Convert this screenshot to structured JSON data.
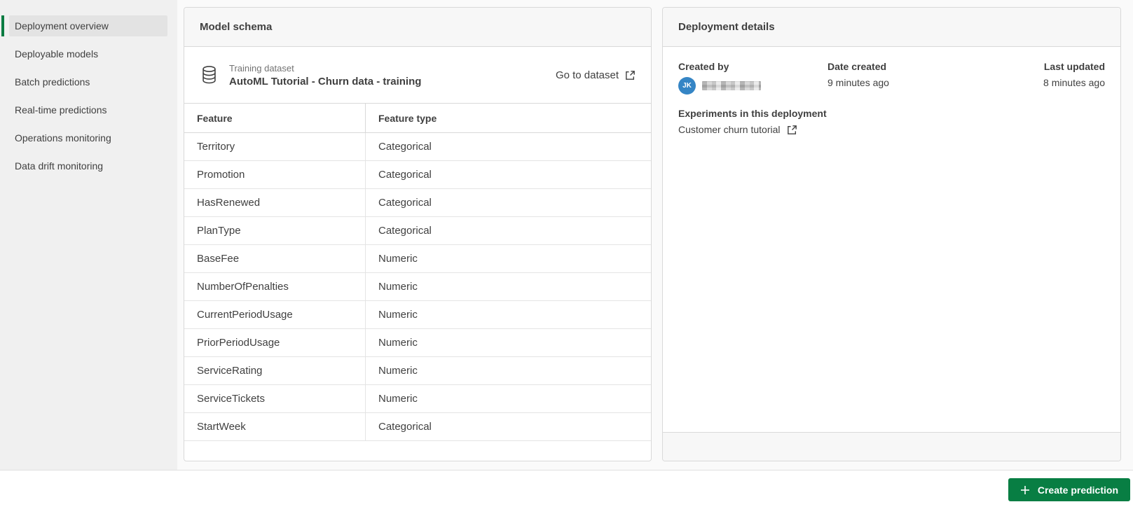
{
  "sidebar": {
    "items": [
      {
        "label": "Deployment overview",
        "selected": true
      },
      {
        "label": "Deployable models",
        "selected": false
      },
      {
        "label": "Batch predictions",
        "selected": false
      },
      {
        "label": "Real-time predictions",
        "selected": false
      },
      {
        "label": "Operations monitoring",
        "selected": false
      },
      {
        "label": "Data drift monitoring",
        "selected": false
      }
    ]
  },
  "model_schema": {
    "title": "Model schema",
    "dataset_label": "Training dataset",
    "dataset_name": "AutoML Tutorial - Churn data - training",
    "go_to_dataset_label": "Go to dataset",
    "table": {
      "columns": [
        "Feature",
        "Feature type"
      ],
      "rows": [
        [
          "Territory",
          "Categorical"
        ],
        [
          "Promotion",
          "Categorical"
        ],
        [
          "HasRenewed",
          "Categorical"
        ],
        [
          "PlanType",
          "Categorical"
        ],
        [
          "BaseFee",
          "Numeric"
        ],
        [
          "NumberOfPenalties",
          "Numeric"
        ],
        [
          "CurrentPeriodUsage",
          "Numeric"
        ],
        [
          "PriorPeriodUsage",
          "Numeric"
        ],
        [
          "ServiceRating",
          "Numeric"
        ],
        [
          "ServiceTickets",
          "Numeric"
        ],
        [
          "StartWeek",
          "Categorical"
        ]
      ]
    }
  },
  "deployment_details": {
    "title": "Deployment details",
    "created_by_label": "Created by",
    "creator_initials": "JK",
    "date_created_label": "Date created",
    "date_created_value": "9 minutes ago",
    "last_updated_label": "Last updated",
    "last_updated_value": "8 minutes ago",
    "experiments_label": "Experiments in this deployment",
    "experiment_name": "Customer churn tutorial"
  },
  "footer": {
    "create_prediction_label": "Create prediction"
  },
  "icons": {
    "dataset": "database-icon",
    "go_to_dataset": "external-link-icon",
    "experiment_link": "external-link-icon",
    "create_prediction": "plus-icon"
  },
  "colors": {
    "accent_green": "#0b7c42",
    "button_green": "#087e43",
    "avatar_blue": "#3585c5",
    "sidebar_bg": "#f0f0f0",
    "selected_item_bg": "#e3e3e3",
    "card_header_bg": "#f7f7f7",
    "card_border": "#d9d9d9",
    "text_primary": "#404040",
    "text_muted": "#737373"
  }
}
